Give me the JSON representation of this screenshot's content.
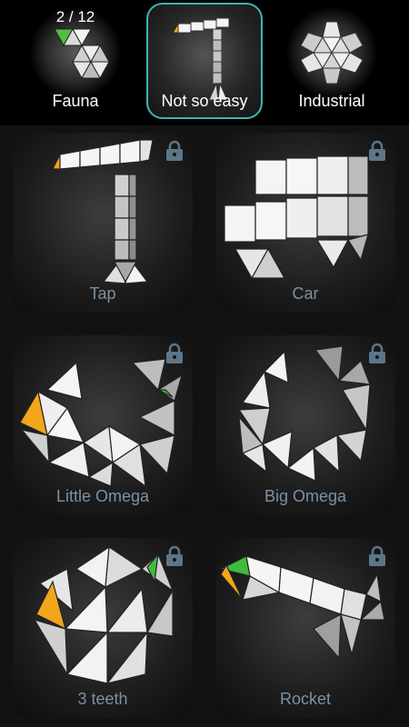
{
  "categories": [
    {
      "label": "Fauna",
      "count": "2 / 12",
      "icon": "fauna-animal-icon"
    },
    {
      "label": "Not so easy",
      "selected": true,
      "icon": "tap-shape-icon"
    },
    {
      "label": "Industrial",
      "icon": "gear-flower-icon"
    }
  ],
  "puzzles": [
    {
      "name": "Tap",
      "locked": true
    },
    {
      "name": "Car",
      "locked": true
    },
    {
      "name": "Little Omega",
      "locked": true
    },
    {
      "name": "Big Omega",
      "locked": true
    },
    {
      "name": "3 teeth",
      "locked": true
    },
    {
      "name": "Rocket",
      "locked": true
    }
  ],
  "colors": {
    "background": "#121212",
    "selected_border": "#3fb6b2",
    "puzzle_label": "#7a91a6",
    "lock": "#5c7689",
    "accent_orange": "#f3a51b",
    "accent_green": "#3dbb3d"
  }
}
